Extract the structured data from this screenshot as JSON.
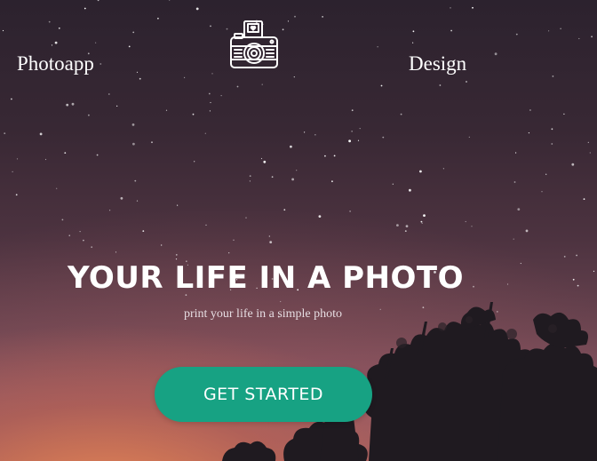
{
  "nav": {
    "brand": "Photoapp",
    "design": "Design",
    "logo_icon": "camera-icon"
  },
  "hero": {
    "headline": "YOUR LIFE IN A PHOTO",
    "subline": "print your life in a simple photo",
    "cta_label": "GET STARTED"
  },
  "colors": {
    "cta_background": "#17a283",
    "text": "#ffffff",
    "sky_top": "#2c222e",
    "horizon_glow": "#ee8a52"
  }
}
